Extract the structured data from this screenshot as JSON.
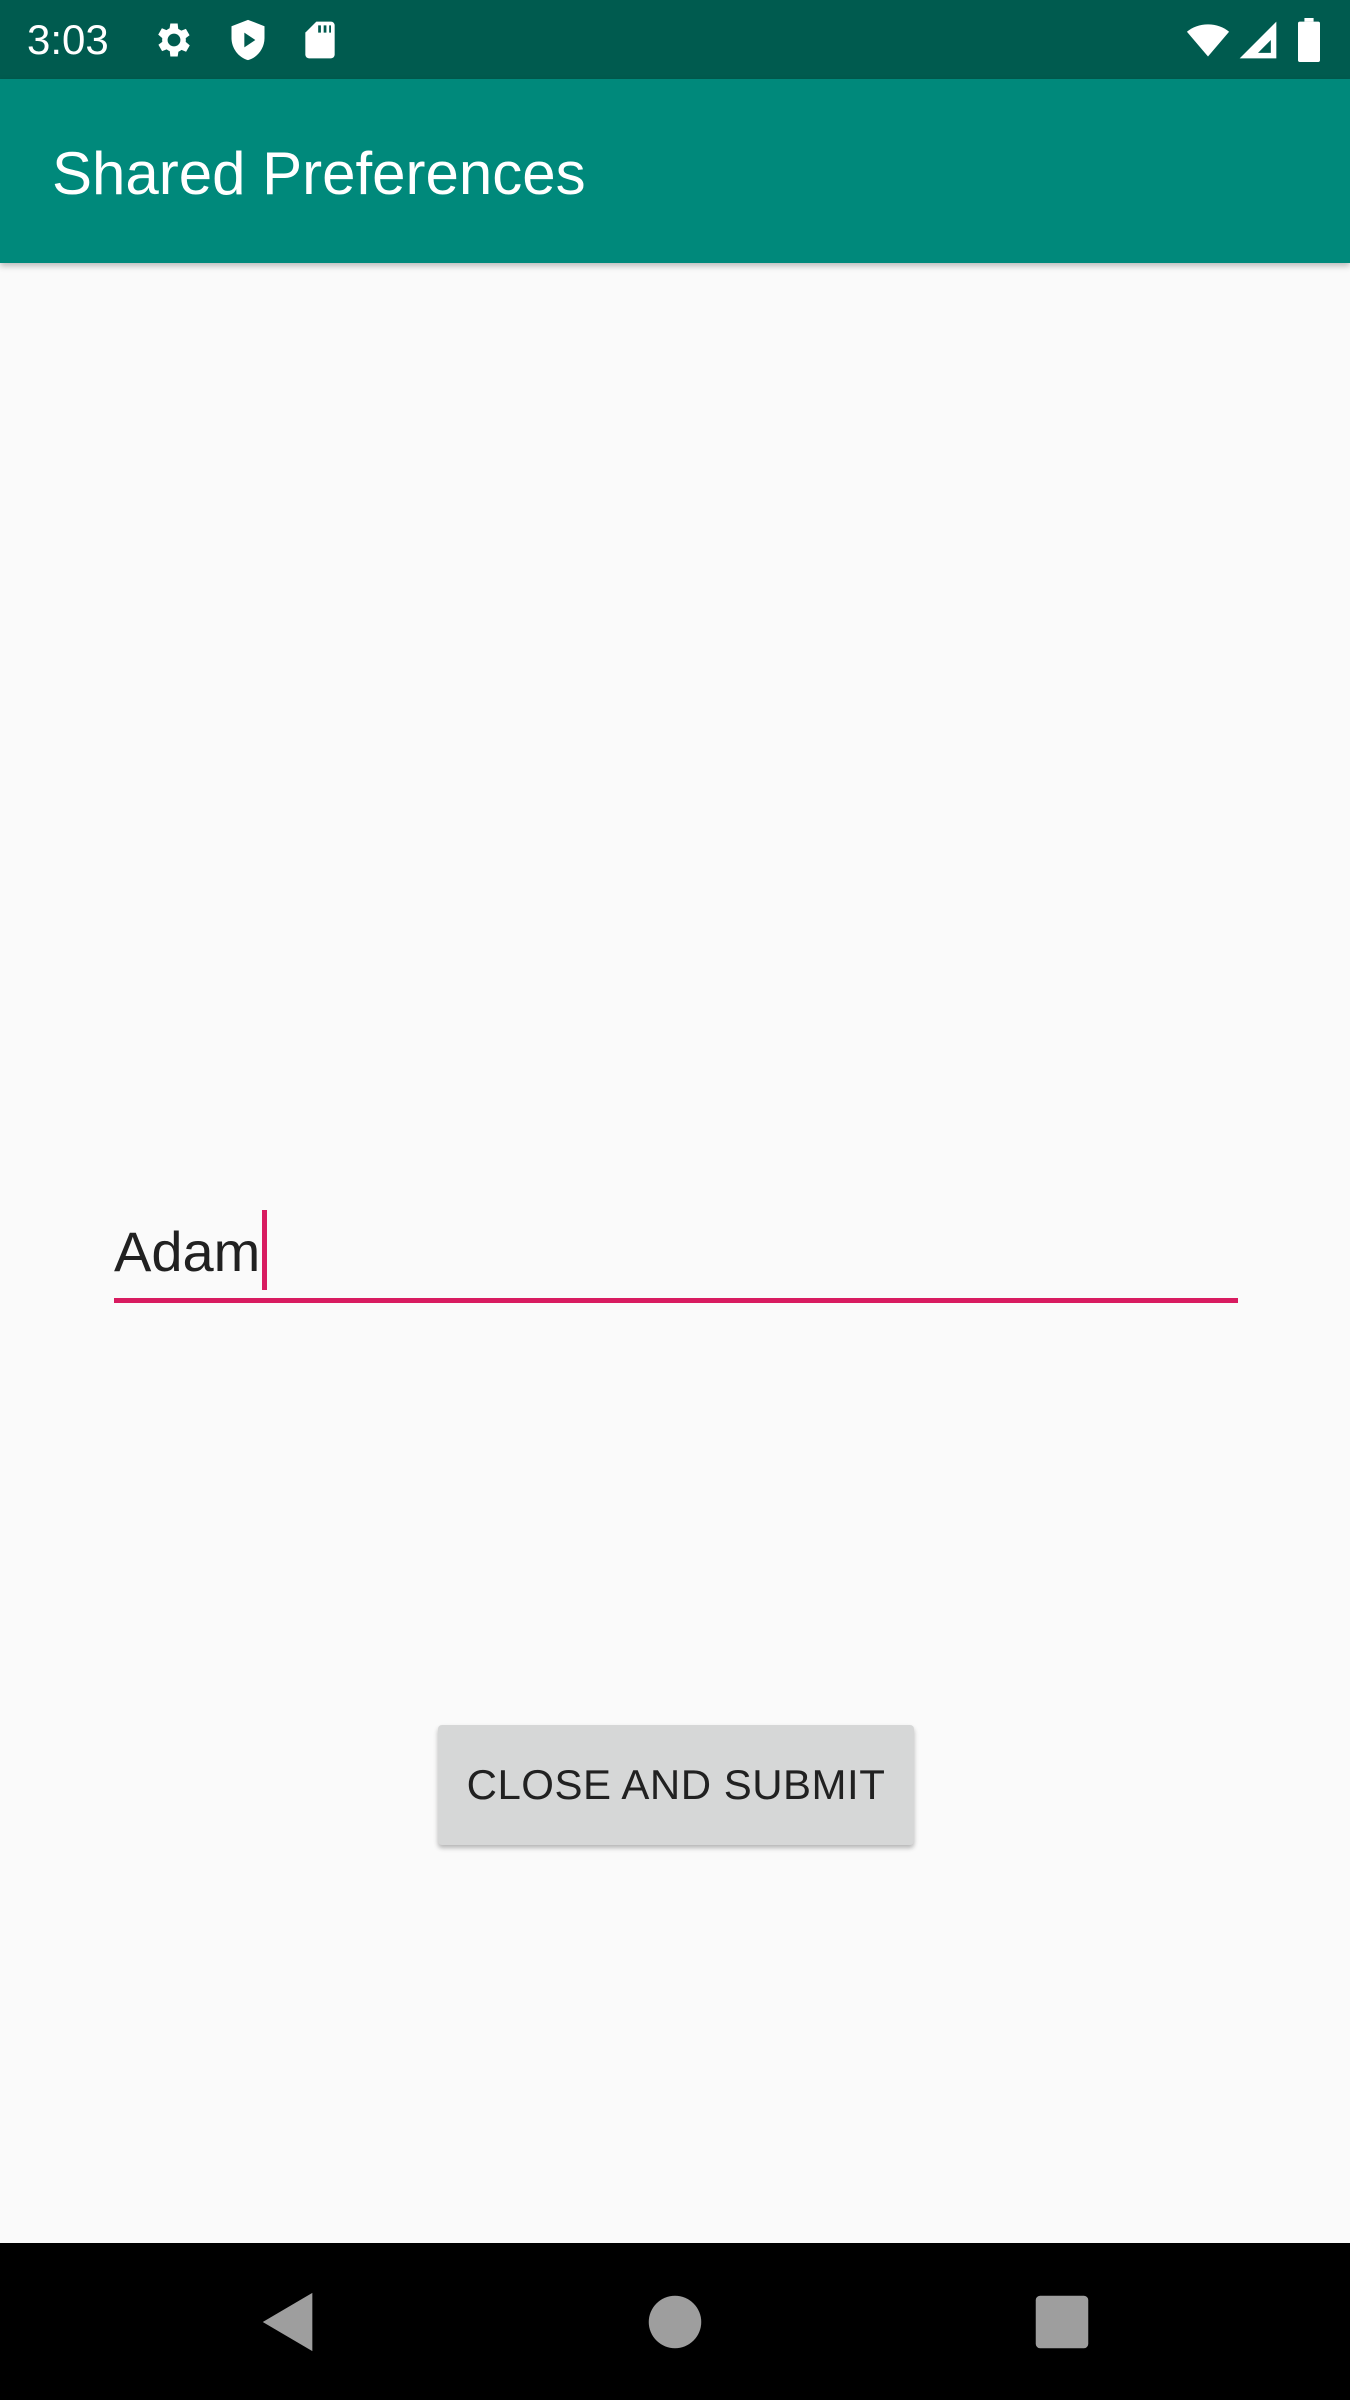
{
  "status_bar": {
    "time": "3:03",
    "icons": [
      "gear-icon",
      "shield-play-icon",
      "sd-card-icon",
      "wifi-icon",
      "signal-icon",
      "battery-icon"
    ]
  },
  "app_bar": {
    "title": "Shared Preferences",
    "color": "#00897b"
  },
  "form": {
    "name_value": "Adam",
    "accent_color": "#d81b60",
    "submit_label": "CLOSE AND SUBMIT"
  },
  "nav_bar": {
    "buttons": [
      "back-icon",
      "home-icon",
      "recents-icon"
    ]
  }
}
